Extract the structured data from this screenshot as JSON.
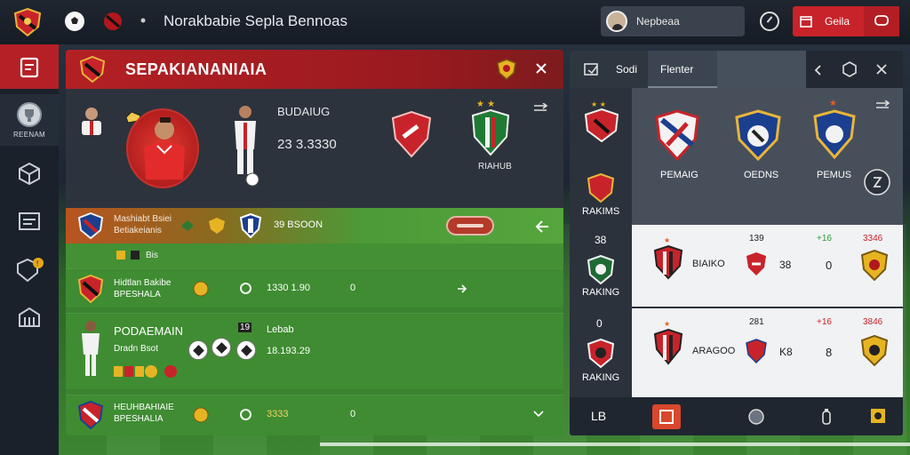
{
  "topbar": {
    "title": "Norakbabie Sepla Bennoas",
    "profile_name": "Nepbeaa",
    "red_button_label": "Geila"
  },
  "sidebar": {
    "items": [
      {
        "icon": "clipboard-icon",
        "label": ""
      },
      {
        "icon": "trophy-icon",
        "label": "REENAM"
      },
      {
        "icon": "box-icon",
        "label": ""
      },
      {
        "icon": "card-icon",
        "label": ""
      },
      {
        "icon": "shield-check-icon",
        "label": ""
      },
      {
        "icon": "stadium-icon",
        "label": ""
      }
    ]
  },
  "main": {
    "title": "SEPAKIANANIAIA",
    "hero": {
      "heading": "BUDAIUG",
      "score": "23  3.3330",
      "team_label": "RIAHUB"
    },
    "top_row": {
      "name_line1": "Mashiabt Bsiei",
      "name_line2": "Betiakeianis",
      "score": "39 BSOON",
      "sub_text": "Bis"
    },
    "rows": [
      {
        "name_line1": "Hidtlan Bakibe",
        "name_line2": "BPESHALA",
        "score": "1330 1.90",
        "extra": "0"
      },
      {
        "name_line1": "PODAEMAIN",
        "name_line2": "Dradn Bsot",
        "score_top": "Lebab",
        "score_badge": "19",
        "score_bottom": "18.193.29"
      },
      {
        "name_line1": "HEUHBAHIAIE",
        "name_line2": "BPESHALIA",
        "score": "3333",
        "extra": "0"
      }
    ]
  },
  "right": {
    "tabs": [
      "Sodi",
      "Flenter"
    ],
    "teams": [
      "PEMAIG",
      "OEDNS",
      "PEMUS"
    ],
    "ranking_label": "RAKIMS",
    "rows": [
      {
        "rank": "38",
        "label": "RAKING",
        "col1": "BIAIKO",
        "col2_top": "139",
        "col2": "38",
        "col3_top": "+16",
        "col3": "0",
        "col4_top": "3346"
      },
      {
        "rank": "0",
        "label": "RAKING",
        "col1": "ARAGOO",
        "col2_top": "281",
        "col2": "K8",
        "col3_top": "+16",
        "col3": "8",
        "col4_top": "3846"
      }
    ],
    "bottom_label": "LB"
  }
}
